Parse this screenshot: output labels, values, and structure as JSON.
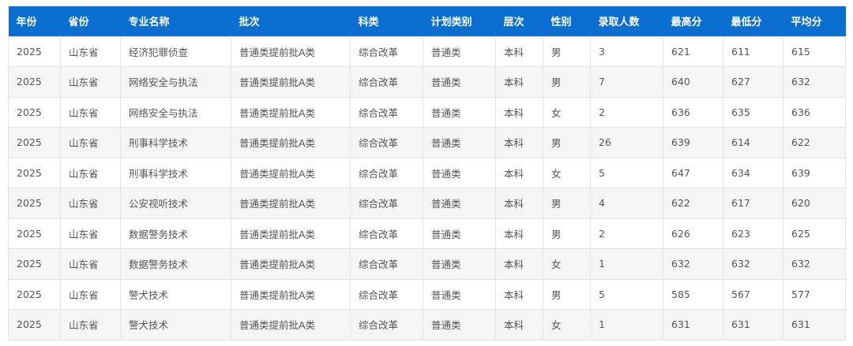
{
  "table": {
    "columns": [
      "年份",
      "省份",
      "专业名称",
      "批次",
      "科类",
      "计划类别",
      "层次",
      "性别",
      "录取人数",
      "最高分",
      "最低分",
      "平均分"
    ],
    "rows": [
      [
        "2025",
        "山东省",
        "经济犯罪侦查",
        "普通类提前批A类",
        "综合改革",
        "普通类",
        "本科",
        "男",
        "3",
        "621",
        "611",
        "615"
      ],
      [
        "2025",
        "山东省",
        "网络安全与执法",
        "普通类提前批A类",
        "综合改革",
        "普通类",
        "本科",
        "男",
        "7",
        "640",
        "627",
        "632"
      ],
      [
        "2025",
        "山东省",
        "网络安全与执法",
        "普通类提前批A类",
        "综合改革",
        "普通类",
        "本科",
        "女",
        "2",
        "636",
        "635",
        "636"
      ],
      [
        "2025",
        "山东省",
        "刑事科学技术",
        "普通类提前批A类",
        "综合改革",
        "普通类",
        "本科",
        "男",
        "26",
        "639",
        "614",
        "622"
      ],
      [
        "2025",
        "山东省",
        "刑事科学技术",
        "普通类提前批A类",
        "综合改革",
        "普通类",
        "本科",
        "女",
        "5",
        "647",
        "634",
        "639"
      ],
      [
        "2025",
        "山东省",
        "公安视听技术",
        "普通类提前批A类",
        "综合改革",
        "普通类",
        "本科",
        "男",
        "4",
        "622",
        "617",
        "620"
      ],
      [
        "2025",
        "山东省",
        "数据警务技术",
        "普通类提前批A类",
        "综合改革",
        "普通类",
        "本科",
        "男",
        "2",
        "626",
        "623",
        "625"
      ],
      [
        "2025",
        "山东省",
        "数据警务技术",
        "普通类提前批A类",
        "综合改革",
        "普通类",
        "本科",
        "女",
        "1",
        "632",
        "632",
        "632"
      ],
      [
        "2025",
        "山东省",
        "警犬技术",
        "普通类提前批A类",
        "综合改革",
        "普通类",
        "本科",
        "男",
        "5",
        "585",
        "567",
        "577"
      ],
      [
        "2025",
        "山东省",
        "警犬技术",
        "普通类提前批A类",
        "综合改革",
        "普通类",
        "本科",
        "女",
        "1",
        "631",
        "631",
        "631"
      ]
    ]
  },
  "colors": {
    "header_bg": "#0a6fd0",
    "header_text": "#ffffff",
    "row_alt_bg": "#f5f5f5",
    "cell_text": "#555555",
    "border": "#e3e3e3"
  }
}
